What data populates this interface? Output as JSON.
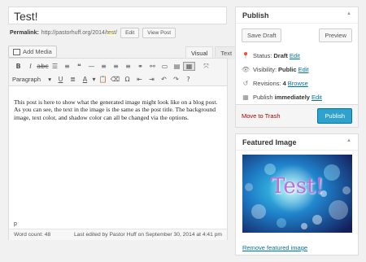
{
  "post": {
    "title": "Test!",
    "permalink_label": "Permalink:",
    "permalink_base": "http://pastorhuff.org/2014/",
    "permalink_slug": "test",
    "permalink_trail": "/",
    "edit_label": "Edit",
    "view_label": "View Post"
  },
  "editor": {
    "add_media_label": "Add Media",
    "tab_visual": "Visual",
    "tab_text": "Text",
    "format_select": "Paragraph",
    "body": "This post is here to show what the generated image might look like on a blog post. As you can see, the text in the image is the same as the post title. The background image, text color, and shadow color can all be changed via the options.",
    "path": "p",
    "word_count": "Word count: 48",
    "last_edited": "Last edited by Pastor Huff on September 30, 2014 at 4:41 pm"
  },
  "publish": {
    "heading": "Publish",
    "save_draft": "Save Draft",
    "preview": "Preview",
    "status_label": "Status:",
    "status_value": "Draft",
    "visibility_label": "Visibility:",
    "visibility_value": "Public",
    "revisions_label": "Revisions:",
    "revisions_value": "4",
    "browse": "Browse",
    "publish_label": "Publish",
    "publish_value": "immediately",
    "edit": "Edit",
    "trash": "Move to Trash",
    "publish_button": "Publish"
  },
  "featured": {
    "heading": "Featured Image",
    "image_text": "Test!",
    "remove": "Remove featured image"
  },
  "colors": {
    "accent": "#2ea2cc",
    "link": "#0074a2",
    "trash": "#aa0000"
  }
}
